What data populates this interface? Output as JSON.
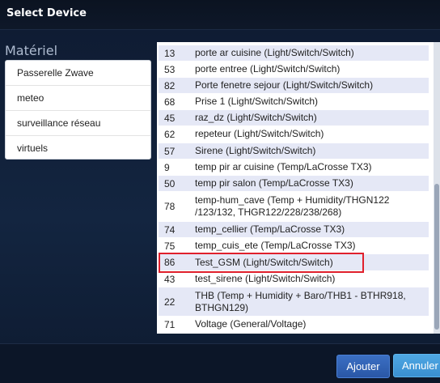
{
  "dialog": {
    "title": "Select Device"
  },
  "hardware": {
    "label": "Matériel",
    "items": [
      "Passerelle Zwave",
      "meteo",
      "surveillance réseau",
      "virtuels"
    ]
  },
  "devices": [
    {
      "id": "13",
      "name": "porte ar cuisine (Light/Switch/Switch)"
    },
    {
      "id": "53",
      "name": "porte entree (Light/Switch/Switch)"
    },
    {
      "id": "82",
      "name": "Porte fenetre sejour (Light/Switch/Switch)"
    },
    {
      "id": "68",
      "name": "Prise 1 (Light/Switch/Switch)"
    },
    {
      "id": "45",
      "name": "raz_dz (Light/Switch/Switch)"
    },
    {
      "id": "62",
      "name": "repeteur (Light/Switch/Switch)"
    },
    {
      "id": "57",
      "name": "Sirene (Light/Switch/Switch)"
    },
    {
      "id": "9",
      "name": "temp pir ar cuisine (Temp/LaCrosse TX3)"
    },
    {
      "id": "50",
      "name": "temp pir salon (Temp/LaCrosse TX3)"
    },
    {
      "id": "78",
      "name": "temp-hum_cave (Temp + Humidity/THGN122 /123/132, THGR122/228/238/268)"
    },
    {
      "id": "74",
      "name": "temp_cellier (Temp/LaCrosse TX3)"
    },
    {
      "id": "75",
      "name": "temp_cuis_ete (Temp/LaCrosse TX3)"
    },
    {
      "id": "86",
      "name": "Test_GSM (Light/Switch/Switch)"
    },
    {
      "id": "43",
      "name": "test_sirene (Light/Switch/Switch)"
    },
    {
      "id": "22",
      "name": "THB (Temp + Humidity + Baro/THB1 - BTHR918, BTHGN129)"
    },
    {
      "id": "71",
      "name": "Voltage (General/Voltage)"
    }
  ],
  "buttons": {
    "add": "Ajouter",
    "cancel": "Annuler"
  },
  "colors": {
    "highlight": "#e0202c",
    "row_alt": "#e5e8f6",
    "add_button": "#2f61b3",
    "cancel_button": "#43a0dc"
  }
}
